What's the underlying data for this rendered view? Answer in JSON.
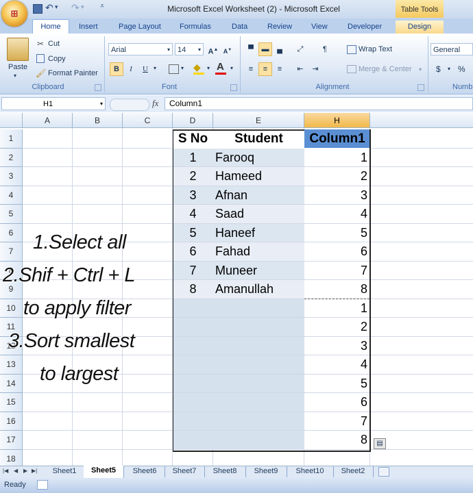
{
  "titlebar": {
    "title": "Microsoft Excel Worksheet (2) - Microsoft Excel",
    "context_tab": "Table Tools"
  },
  "ribbon_tabs": [
    "Home",
    "Insert",
    "Page Layout",
    "Formulas",
    "Data",
    "Review",
    "View",
    "Developer",
    "Design"
  ],
  "ribbon": {
    "clipboard": {
      "paste": "Paste",
      "cut": "Cut",
      "copy": "Copy",
      "format_painter": "Format Painter",
      "label": "Clipboard"
    },
    "font": {
      "font_name": "Arial",
      "font_size": "14",
      "label": "Font",
      "bold": "B",
      "italic": "I",
      "underline": "U"
    },
    "alignment": {
      "wrap_text": "Wrap Text",
      "merge_center": "Merge & Center",
      "label": "Alignment"
    },
    "number": {
      "format": "General",
      "currency": "$",
      "percent": "%",
      "label": "Numb"
    }
  },
  "formula_bar": {
    "name_box": "H1",
    "fx": "fx",
    "content": "Column1"
  },
  "columns": [
    "A",
    "B",
    "C",
    "D",
    "E",
    "H"
  ],
  "rows": [
    "1",
    "2",
    "3",
    "4",
    "5",
    "6",
    "7",
    "8",
    "9",
    "10",
    "11",
    "12",
    "13",
    "14",
    "15",
    "16",
    "17",
    "18"
  ],
  "table": {
    "headers": {
      "sno": "S No",
      "student": "Student",
      "column1": "Column1"
    },
    "sno": [
      "1",
      "2",
      "3",
      "4",
      "5",
      "6",
      "7",
      "8"
    ],
    "students": [
      "Farooq",
      "Hameed",
      "Afnan",
      "Saad",
      "Haneef",
      "Fahad",
      "Muneer",
      "Amanullah"
    ],
    "column1": [
      "1",
      "2",
      "3",
      "4",
      "5",
      "6",
      "7",
      "8",
      "1",
      "2",
      "3",
      "4",
      "5",
      "6",
      "7",
      "8"
    ]
  },
  "instructions": [
    "1.Select all",
    "2.Shif + Ctrl + L",
    "to apply filter",
    "3.Sort smallest",
    "to largest"
  ],
  "sheet_tabs": [
    "Sheet1",
    "Sheet5",
    "Sheet6",
    "Sheet7",
    "Sheet8",
    "Sheet9",
    "Sheet10",
    "Sheet2"
  ],
  "active_sheet": "Sheet5",
  "status": {
    "ready": "Ready"
  }
}
